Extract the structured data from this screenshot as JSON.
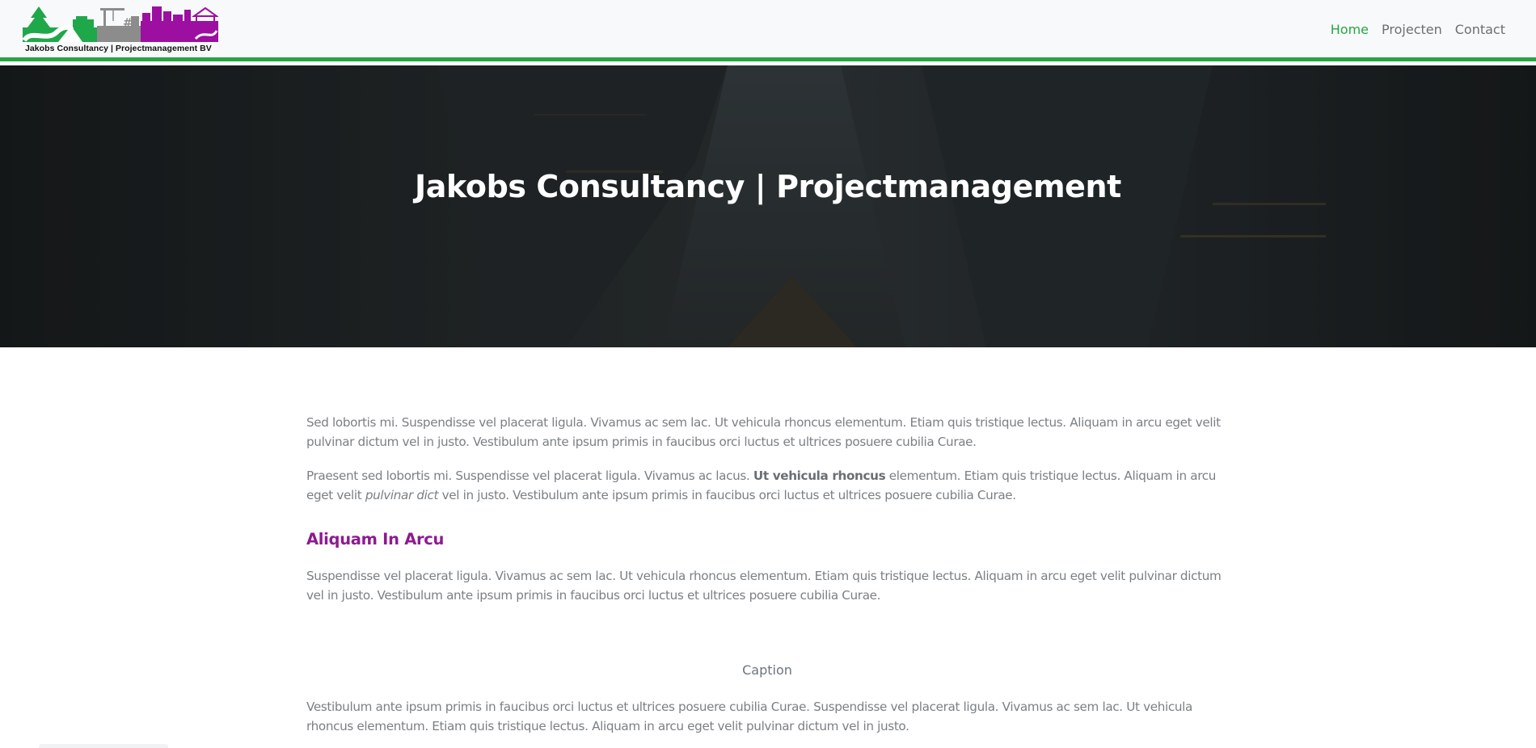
{
  "logo": {
    "text": "Jakobs Consultancy | Projectmanagement BV",
    "colors": {
      "green": "#1fa84a",
      "gray": "#8c8c8c",
      "purple": "#9c0fa0"
    }
  },
  "nav": {
    "items": [
      {
        "label": "Home",
        "active": true
      },
      {
        "label": "Projecten",
        "active": false
      },
      {
        "label": "Contact",
        "active": false
      }
    ],
    "accent_color": "#27a543"
  },
  "hero": {
    "title": "Jakobs Consultancy | Projectmanagement"
  },
  "content": {
    "p1": "Sed lobortis mi. Suspendisse vel placerat ligula. Vivamus ac sem lac. Ut vehicula rhoncus elementum. Etiam quis tristique lectus. Aliquam in arcu eget velit pulvinar dictum vel in justo. Vestibulum ante ipsum primis in faucibus orci luctus et ultrices posuere cubilia Curae.",
    "p2": {
      "part1": "Praesent sed lobortis mi. Suspendisse vel placerat ligula. Vivamus ac lacus. ",
      "bold": "Ut vehicula rhoncus",
      "part2": " elementum. Etiam quis tristique lectus. Aliquam in arcu eget velit ",
      "italic": "pulvinar dict",
      "part3": " vel in justo. Vestibulum ante ipsum primis in faucibus orci luctus et ultrices posuere cubilia Curae."
    },
    "heading": "Aliquam In Arcu",
    "heading_color": "#8e1a91",
    "p3": "Suspendisse vel placerat ligula. Vivamus ac sem lac. Ut vehicula rhoncus elementum. Etiam quis tristique lectus. Aliquam in arcu eget velit pulvinar dictum vel in justo. Vestibulum ante ipsum primis in faucibus orci luctus et ultrices posuere cubilia Curae.",
    "caption": "Caption",
    "p4": "Vestibulum ante ipsum primis in faucibus orci luctus et ultrices posuere cubilia Curae. Suspendisse vel placerat ligula. Vivamus ac sem lac. Ut vehicula rhoncus elementum. Etiam quis tristique lectus. Aliquam in arcu eget velit pulvinar dictum vel in justo."
  }
}
